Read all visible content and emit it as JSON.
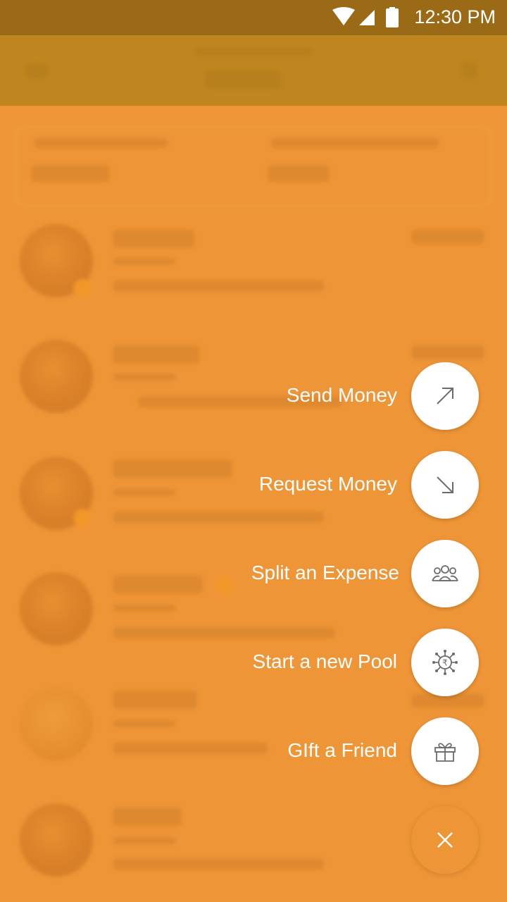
{
  "status_bar": {
    "time": "12:30 PM"
  },
  "speed_dial": {
    "items": [
      {
        "label": "Send Money",
        "icon": "arrow-up-right-icon"
      },
      {
        "label": "Request Money",
        "icon": "arrow-down-right-icon"
      },
      {
        "label": "Split an Expense",
        "icon": "group-icon"
      },
      {
        "label": "Start a new Pool",
        "icon": "rupee-pool-icon"
      },
      {
        "label": "GIft a Friend",
        "icon": "gift-icon"
      }
    ],
    "close_icon": "close-icon"
  },
  "colors": {
    "status_bar": "#9a6a16",
    "app_bar": "#bf861f",
    "overlay": "#ee9537",
    "fab_bg": "#ffffff",
    "icon_stroke": "#6b6b6b"
  }
}
